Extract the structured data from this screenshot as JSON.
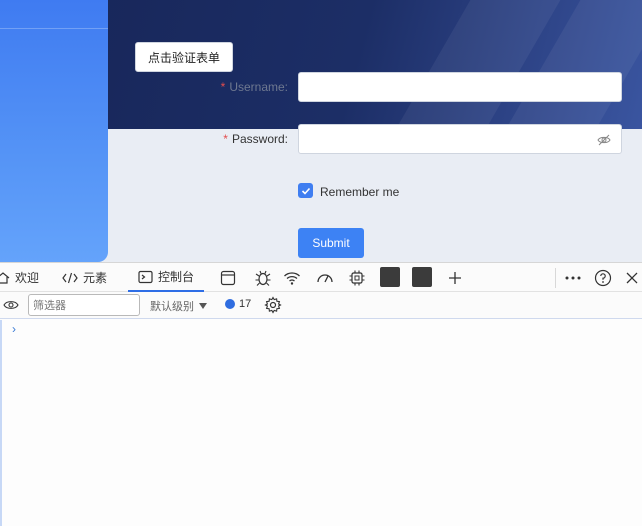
{
  "page": {
    "validate_button": "点击验证表单",
    "form": {
      "required_mark": "*",
      "username_label": "Username:",
      "password_label": "Password:",
      "remember_label": "Remember me",
      "remember_checked": true,
      "submit_label": "Submit"
    }
  },
  "devtools": {
    "tabs": [
      {
        "label": "欢迎",
        "icon": "home-icon"
      },
      {
        "label": "元素",
        "icon": "code-icon"
      },
      {
        "label": "控制台",
        "icon": "console-icon",
        "active": true
      }
    ],
    "tools": [
      "sources-icon",
      "bug-icon",
      "wifi-icon",
      "performance-icon",
      "cpu-icon",
      "panel-a",
      "panel-b",
      "plus-icon"
    ],
    "right_tools": [
      "more-icon",
      "help-icon",
      "close-icon"
    ],
    "filter": {
      "placeholder": "筛选器",
      "level_label": "默认级别",
      "message_count": "17"
    },
    "console_prompt": "›",
    "accent_color": "#2e6ee6"
  }
}
